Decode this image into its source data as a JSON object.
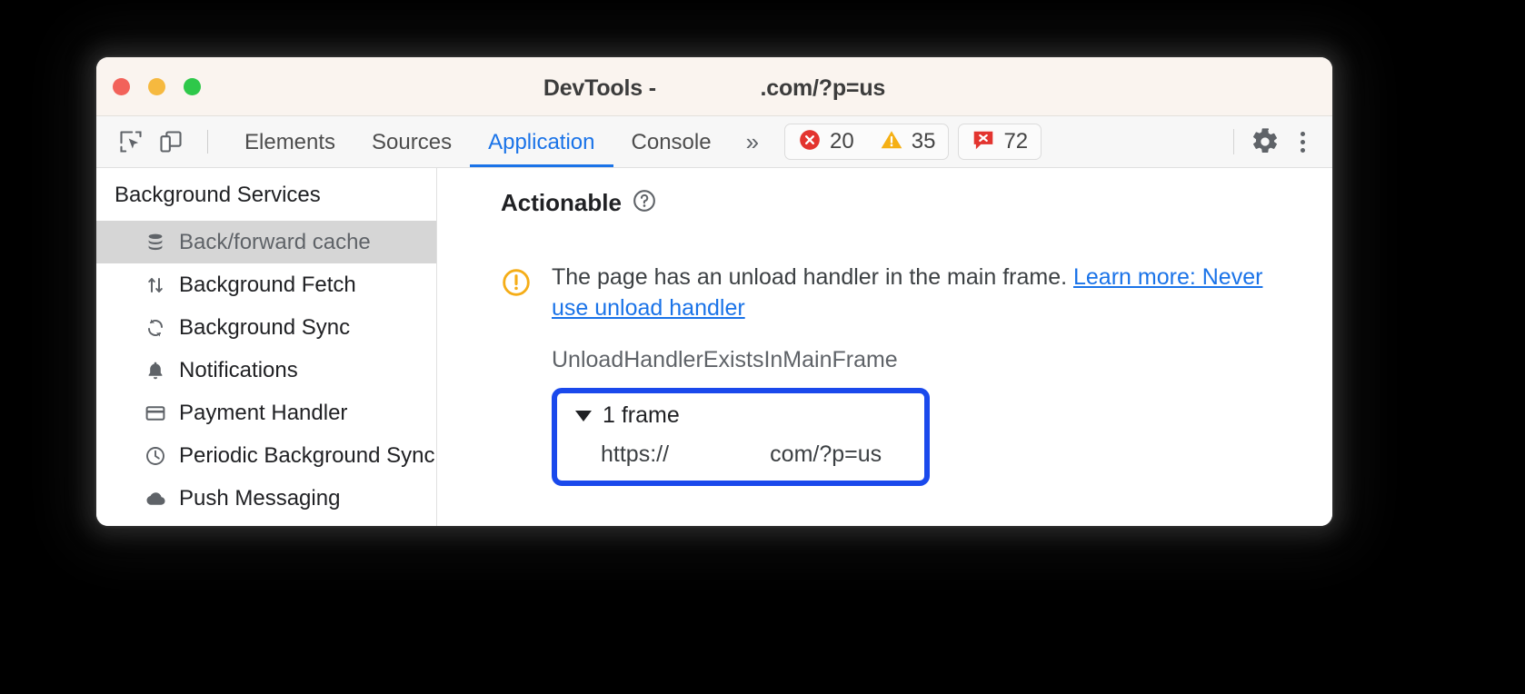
{
  "window": {
    "title": "DevTools -                 .com/?p=us",
    "traffic_lights": [
      {
        "name": "close",
        "color": "#f2625a"
      },
      {
        "name": "minimize",
        "color": "#f6b93f"
      },
      {
        "name": "zoom",
        "color": "#2ec84a"
      }
    ]
  },
  "toolbar": {
    "icons": [
      {
        "name": "inspect-element-icon"
      },
      {
        "name": "device-toolbar-icon"
      }
    ],
    "tabs": [
      {
        "label": "Elements",
        "selected": false
      },
      {
        "label": "Sources",
        "selected": false
      },
      {
        "label": "Application",
        "selected": true
      },
      {
        "label": "Console",
        "selected": false
      }
    ],
    "overflow_label": "»",
    "badges": {
      "errors": "20",
      "warnings": "35",
      "issues": "72"
    },
    "settings_label": "gear-icon",
    "more_label": "kebab-menu-icon",
    "accent_color": "#1a73e8"
  },
  "sidebar": {
    "header": "Background Services",
    "items": [
      {
        "label": "Back/forward cache",
        "icon": "database-icon",
        "selected": true
      },
      {
        "label": "Background Fetch",
        "icon": "arrows-up-down-icon",
        "selected": false
      },
      {
        "label": "Background Sync",
        "icon": "sync-icon",
        "selected": false
      },
      {
        "label": "Notifications",
        "icon": "bell-icon",
        "selected": false
      },
      {
        "label": "Payment Handler",
        "icon": "credit-card-icon",
        "selected": false
      },
      {
        "label": "Periodic Background Sync",
        "icon": "clock-icon",
        "selected": false
      },
      {
        "label": "Push Messaging",
        "icon": "cloud-icon",
        "selected": false
      }
    ]
  },
  "main": {
    "section_title": "Actionable",
    "help_icon": "help-circle-icon",
    "issue": {
      "status_icon": "warning-circle-icon",
      "text_before_link": "The page has an unload handler in the main frame. ",
      "link_text": "Learn more: Never use unload handler",
      "reason_code": "UnloadHandlerExistsInMainFrame"
    },
    "frame_tree": {
      "toggle_label": "1 frame",
      "expanded": true,
      "url": "https://                com/?p=us",
      "highlight_color": "#1a49ec"
    }
  }
}
